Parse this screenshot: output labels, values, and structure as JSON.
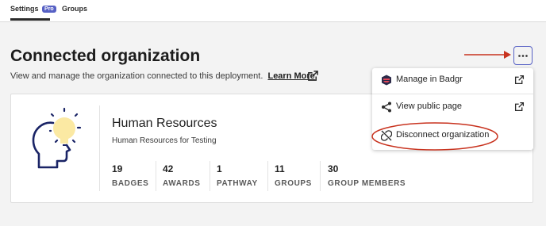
{
  "tabs": {
    "settings_label": "Settings",
    "pro_badge": "Pro",
    "groups_label": "Groups"
  },
  "page": {
    "title": "Connected organization",
    "subtitle": "View and manage the organization connected to this deployment.",
    "learn_more": "Learn More"
  },
  "org": {
    "name": "Human Resources",
    "description": "Human Resources for Testing",
    "stats": [
      {
        "value": "19",
        "label": "BADGES"
      },
      {
        "value": "42",
        "label": "AWARDS"
      },
      {
        "value": "1",
        "label": "PATHWAY"
      },
      {
        "value": "11",
        "label": "GROUPS"
      },
      {
        "value": "30",
        "label": "GROUP MEMBERS"
      }
    ]
  },
  "menu": {
    "items": [
      {
        "label": "Manage in Badgr",
        "icon": "badgr-logo-icon"
      },
      {
        "label": "View public page",
        "icon": "share-icon"
      },
      {
        "label": "Disconnect organization",
        "icon": "unlink-icon"
      }
    ]
  },
  "colors": {
    "accent": "#5660c4",
    "annotation": "#c8321e",
    "illustration_navy": "#1a2466",
    "illustration_bulb": "#fbe9a3"
  }
}
